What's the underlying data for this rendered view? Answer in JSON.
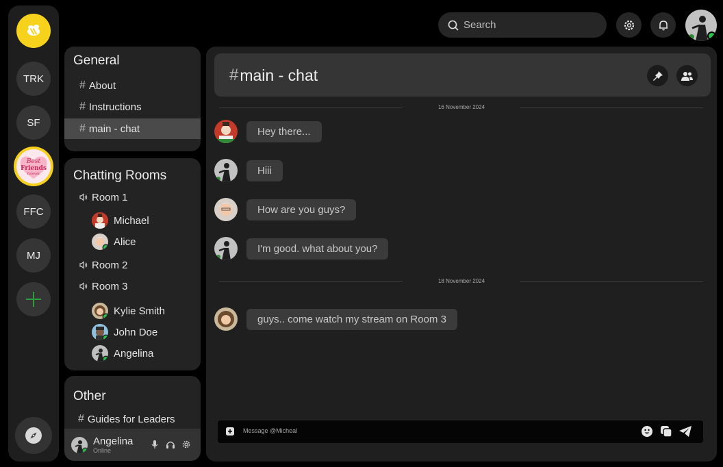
{
  "servers": [
    {
      "icon": "bee-logo-icon"
    },
    {
      "label": "TRK"
    },
    {
      "label": "SF"
    },
    {
      "label": "Best Friends Forever",
      "selected": true
    },
    {
      "label": "FFC"
    },
    {
      "label": "MJ"
    },
    {
      "icon": "plus-icon",
      "color": "#2e9b3e"
    }
  ],
  "explore_icon": "compass-icon",
  "general": {
    "title": "General",
    "channels": [
      "About",
      "Instructions",
      "main - chat"
    ],
    "active": "main - chat"
  },
  "rooms": {
    "title": "Chatting Rooms",
    "list": [
      {
        "name": "Room 1",
        "members": [
          "Michael",
          "Alice"
        ]
      },
      {
        "name": "Room 2",
        "members": []
      },
      {
        "name": "Room 3",
        "members": [
          "Kylie Smith",
          "John Doe",
          "Angelina"
        ]
      }
    ]
  },
  "other": {
    "title": "Other",
    "channels": [
      "Guides for Leaders"
    ]
  },
  "current_user": {
    "name": "Angelina",
    "status": "Online"
  },
  "search": {
    "placeholder": "Search"
  },
  "chat": {
    "title": "main - chat",
    "composer_placeholder": "Message @Micheal",
    "groups": [
      {
        "date": "16 November 2024",
        "messages": [
          {
            "text": "Hey there..."
          },
          {
            "text": "Hiii"
          },
          {
            "text": "How are you guys?"
          },
          {
            "text": "I'm good. what about you?"
          }
        ]
      },
      {
        "date": "18 November 2024",
        "messages": [
          {
            "text": "guys.. come watch my stream on Room 3"
          }
        ]
      }
    ]
  },
  "colors": {
    "accent_yellow": "#f7d21c",
    "online": "#2bbf4a",
    "bg": "#000000",
    "panel": "#232323"
  }
}
